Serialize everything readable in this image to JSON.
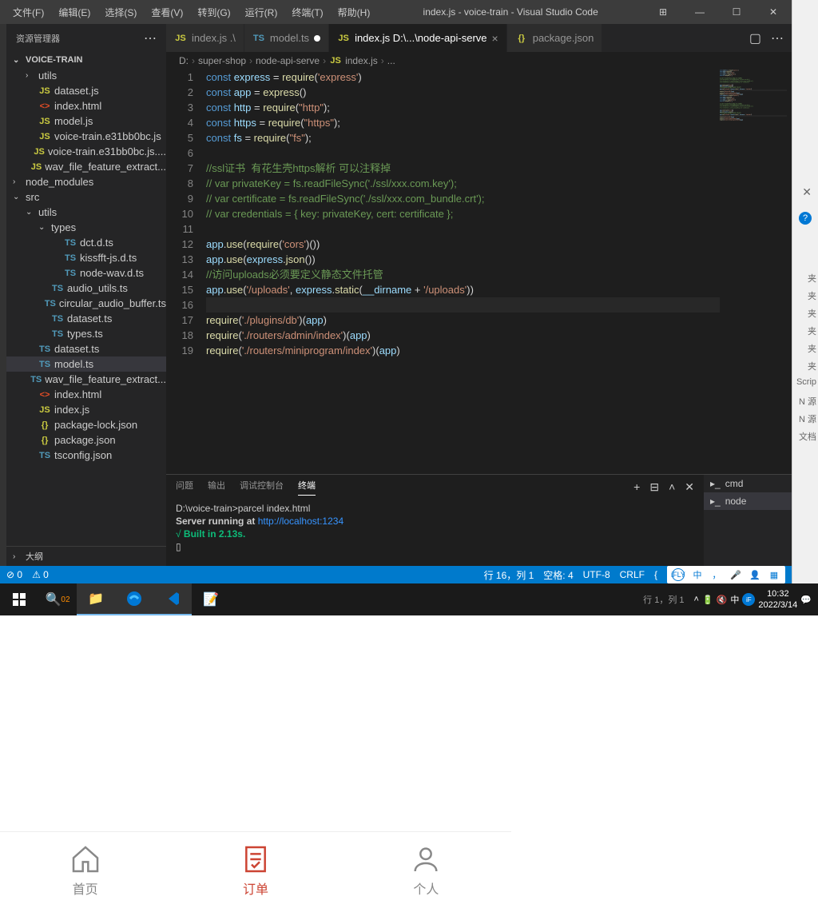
{
  "titlebar": {
    "menus": [
      "文件(F)",
      "编辑(E)",
      "选择(S)",
      "查看(V)",
      "转到(G)",
      "运行(R)",
      "终端(T)",
      "帮助(H)"
    ],
    "title": "index.js - voice-train - Visual Studio Code"
  },
  "sidebar": {
    "header": "资源管理器",
    "project": "VOICE-TRAIN",
    "outline": "大纲",
    "files": [
      {
        "t": "folder",
        "l": "utils",
        "i": 1,
        "open": false
      },
      {
        "t": "js",
        "l": "dataset.js",
        "i": 1
      },
      {
        "t": "html",
        "l": "index.html",
        "i": 1
      },
      {
        "t": "js",
        "l": "model.js",
        "i": 1
      },
      {
        "t": "js",
        "l": "voice-train.e31bb0bc.js",
        "i": 1
      },
      {
        "t": "js",
        "l": "voice-train.e31bb0bc.js....",
        "i": 1
      },
      {
        "t": "js",
        "l": "wav_file_feature_extract...",
        "i": 1
      },
      {
        "t": "folder",
        "l": "node_modules",
        "i": 0,
        "open": false
      },
      {
        "t": "folder",
        "l": "src",
        "i": 0,
        "open": true
      },
      {
        "t": "folder",
        "l": "utils",
        "i": 1,
        "open": true
      },
      {
        "t": "folder",
        "l": "types",
        "i": 2,
        "open": true
      },
      {
        "t": "ts",
        "l": "dct.d.ts",
        "i": 3
      },
      {
        "t": "ts",
        "l": "kissfft-js.d.ts",
        "i": 3
      },
      {
        "t": "ts",
        "l": "node-wav.d.ts",
        "i": 3
      },
      {
        "t": "ts",
        "l": "audio_utils.ts",
        "i": 2
      },
      {
        "t": "ts",
        "l": "circular_audio_buffer.ts",
        "i": 2
      },
      {
        "t": "ts",
        "l": "dataset.ts",
        "i": 2
      },
      {
        "t": "ts",
        "l": "types.ts",
        "i": 2
      },
      {
        "t": "ts",
        "l": "dataset.ts",
        "i": 1
      },
      {
        "t": "ts",
        "l": "model.ts",
        "i": 1,
        "sel": true
      },
      {
        "t": "ts",
        "l": "wav_file_feature_extract...",
        "i": 1
      },
      {
        "t": "html",
        "l": "index.html",
        "i": 1
      },
      {
        "t": "js",
        "l": "index.js",
        "i": 1
      },
      {
        "t": "json",
        "l": "package-lock.json",
        "i": 1
      },
      {
        "t": "json",
        "l": "package.json",
        "i": 1
      },
      {
        "t": "ts",
        "l": "tsconfig.json",
        "i": 1
      }
    ]
  },
  "tabs": [
    {
      "icon": "js",
      "label": "index.js .\\",
      "mod": false
    },
    {
      "icon": "ts",
      "label": "model.ts",
      "mod": true
    },
    {
      "icon": "js",
      "label": "index.js D:\\...\\node-api-serve",
      "active": true
    },
    {
      "icon": "json",
      "label": "package.json"
    }
  ],
  "breadcrumb": [
    "D:",
    "super-shop",
    "node-api-serve",
    "index.js",
    "..."
  ],
  "bc_icon_at": 3,
  "code_lines": [
    "1",
    "2",
    "3",
    "4",
    "5",
    "6",
    "7",
    "8",
    "9",
    "10",
    "11",
    "12",
    "13",
    "14",
    "15",
    "16",
    "17",
    "18",
    "19"
  ],
  "terminal": {
    "tabs": [
      "问题",
      "输出",
      "调试控制台",
      "终端"
    ],
    "active_tab": 3,
    "side": [
      {
        "l": "cmd"
      },
      {
        "l": "node",
        "active": true
      }
    ],
    "lines": {
      "l1a": "D:\\voice-train>",
      "l1b": "parcel index.html",
      "l2a": "Server running at ",
      "l2b": "http://localhost:1234",
      "l3a": "√  ",
      "l3b": "Built in 2.13s.",
      "l4": "▯"
    }
  },
  "statusbar": {
    "left": [
      "0",
      "⚠ 0"
    ],
    "right": [
      "行 16，列 1",
      "空格: 4",
      "UTF-8",
      "CRLF"
    ]
  },
  "taskbar": {
    "footer": [
      "行 1，列 1"
    ],
    "time": "10:32",
    "date": "2022/3/14"
  },
  "mobile_nav": [
    {
      "l": "首页"
    },
    {
      "l": "订单",
      "active": true
    },
    {
      "l": "个人"
    }
  ],
  "side_texts": [
    "夹",
    "夹",
    "夹",
    "夹",
    "夹",
    "夹",
    "Scrip",
    "N 源",
    "N 源",
    "文档"
  ]
}
